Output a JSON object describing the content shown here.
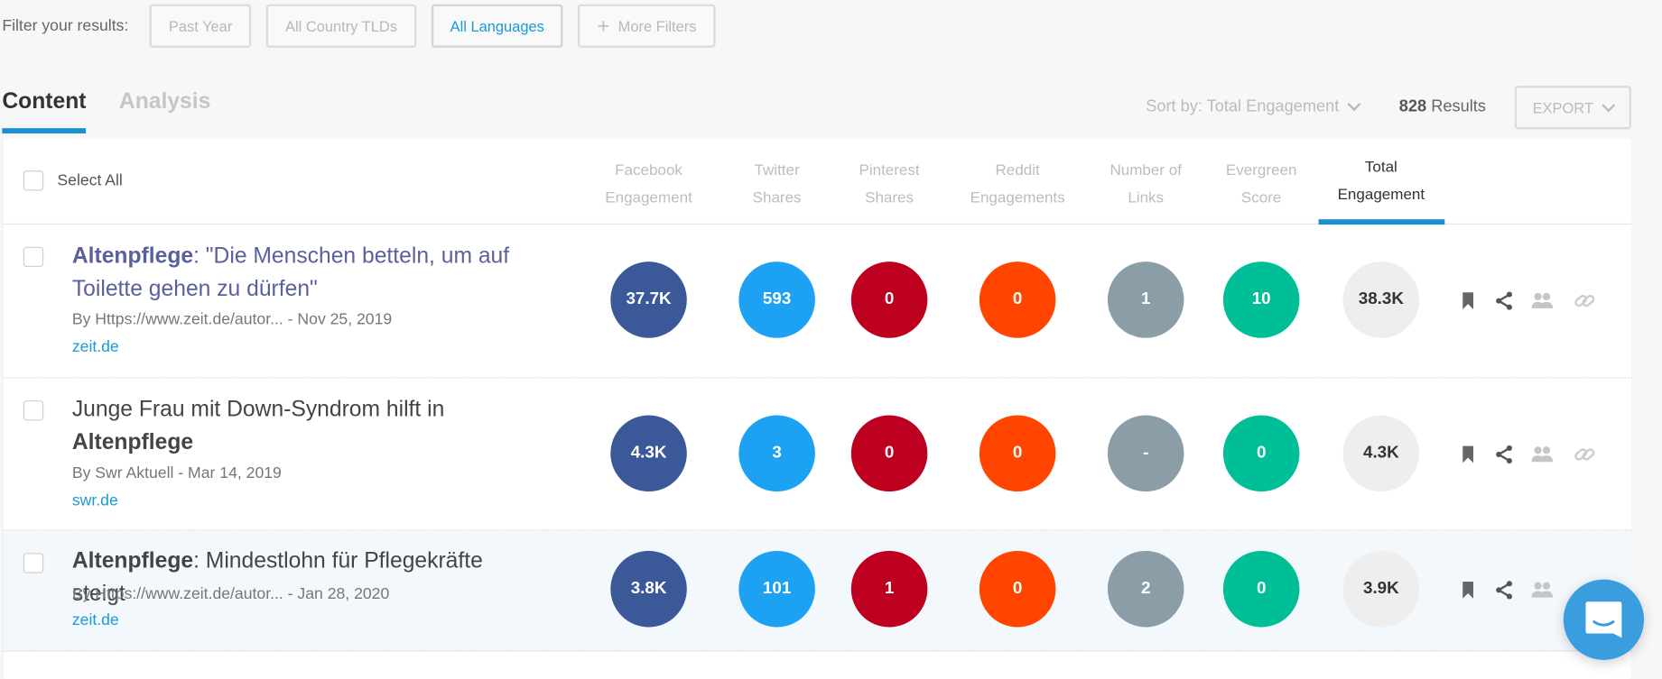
{
  "filters": {
    "label": "Filter your results:",
    "buttons": [
      {
        "label": "Past Year",
        "active": false
      },
      {
        "label": "All Country TLDs",
        "active": false
      },
      {
        "label": "All Languages",
        "active": true
      },
      {
        "label": "More Filters",
        "icon": "plus-icon",
        "active": false
      }
    ]
  },
  "tabs": [
    {
      "label": "Content",
      "active": true
    },
    {
      "label": "Analysis",
      "active": false
    }
  ],
  "sort": {
    "label": "Sort by: Total Engagement"
  },
  "results": {
    "count": "828",
    "label": "Results"
  },
  "export": {
    "label": "EXPORT"
  },
  "table": {
    "select_all_label": "Select All",
    "columns": [
      {
        "line1": "Facebook",
        "line2": "Engagement",
        "color": "#3b5998"
      },
      {
        "line1": "Twitter",
        "line2": "Shares",
        "color": "#1da1f2"
      },
      {
        "line1": "Pinterest",
        "line2": "Shares",
        "color": "#bd001f"
      },
      {
        "line1": "Reddit",
        "line2": "Engagements",
        "color": "#ff4500"
      },
      {
        "line1": "Number of",
        "line2": "Links",
        "color": "#8b9ea7"
      },
      {
        "line1": "Evergreen",
        "line2": "Score",
        "color": "#00bf96"
      },
      {
        "line1": "Total",
        "line2": "Engagement",
        "active": true
      }
    ],
    "rows": [
      {
        "title_bold": "Altenpflege",
        "title_rest": ": \"Die Menschen betteln, um auf Toilette gehen zu dürfen\"",
        "visited": true,
        "byline": "By Https://www.zeit.de/autor... - Nov 25, 2019",
        "domain": "zeit.de",
        "values": [
          "37.7K",
          "593",
          "0",
          "0",
          "1",
          "10",
          "38.3K"
        ],
        "highlighted": false
      },
      {
        "title_pre": "Junge Frau mit Down-Syndrom hilft in ",
        "title_bold_end": "Altenpflege",
        "visited": false,
        "byline": "By Swr Aktuell - Mar 14, 2019",
        "domain": "swr.de",
        "values": [
          "4.3K",
          "3",
          "0",
          "0",
          "-",
          "0",
          "4.3K"
        ],
        "highlighted": false
      },
      {
        "title_bold": "Altenpflege",
        "title_rest": ": Mindestlohn für Pflegekräfte steigt",
        "visited": false,
        "byline": "By Https://www.zeit.de/autor... - Jan 28, 2020",
        "domain": "zeit.de",
        "values": [
          "3.8K",
          "101",
          "1",
          "0",
          "2",
          "0",
          "3.9K"
        ],
        "highlighted": true
      }
    ],
    "row_actions": [
      "bookmark-icon",
      "share-icon",
      "influencers-icon",
      "link-icon"
    ]
  },
  "chat": {
    "icon": "chat-icon"
  }
}
